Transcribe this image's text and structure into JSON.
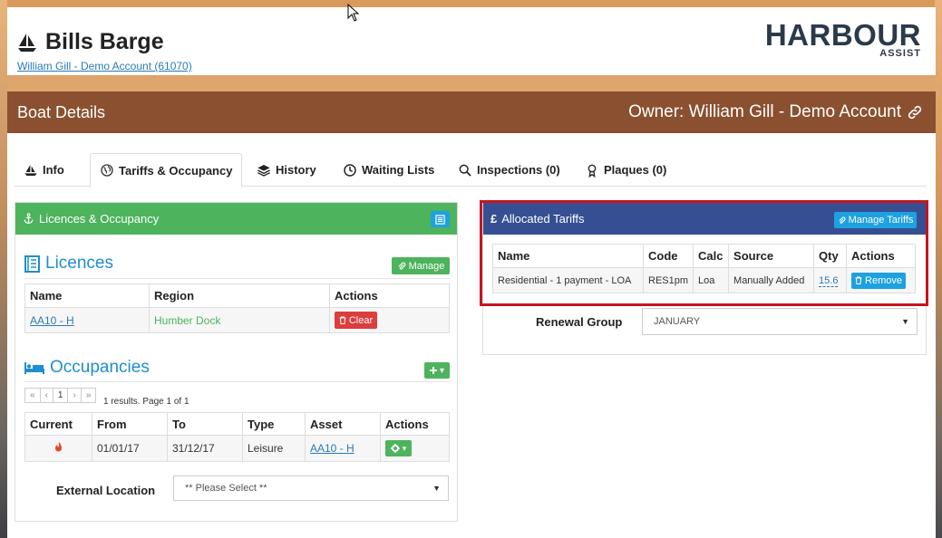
{
  "header": {
    "boat_name": "Bills Barge",
    "account_link": "William Gill - Demo Account (61070)",
    "logo_main": "HARBOUR",
    "logo_sub": "ASSIST"
  },
  "main": {
    "title": "Boat Details",
    "owner": "Owner: William Gill - Demo Account"
  },
  "tabs": [
    {
      "label": "Info"
    },
    {
      "label": "Tariffs & Occupancy"
    },
    {
      "label": "History"
    },
    {
      "label": "Waiting Lists"
    },
    {
      "label": "Inspections (0)"
    },
    {
      "label": "Plaques (0)"
    }
  ],
  "licences_panel": {
    "title": "Licences & Occupancy",
    "licences_title": "Licences",
    "manage_label": "Manage",
    "columns": [
      "Name",
      "Region",
      "Actions"
    ],
    "rows": [
      {
        "name": "AA10 - H",
        "region": "Humber Dock",
        "action": "Clear"
      }
    ],
    "occupancies_title": "Occupancies",
    "pager": [
      "«",
      "‹",
      "1",
      "›",
      "»"
    ],
    "pager_info": "1 results. Page 1 of 1",
    "occ_columns": [
      "Current",
      "From",
      "To",
      "Type",
      "Asset",
      "Actions"
    ],
    "occ_rows": [
      {
        "from": "01/01/17",
        "to": "31/12/17",
        "type": "Leisure",
        "asset": "AA10 - H"
      }
    ],
    "external_location_label": "External Location",
    "external_location_value": "** Please Select **"
  },
  "tariffs_panel": {
    "title": "Allocated Tariffs",
    "manage_label": "Manage Tariffs",
    "columns": [
      "Name",
      "Code",
      "Calc",
      "Source",
      "Qty",
      "Actions"
    ],
    "rows": [
      {
        "name": "Residential - 1 payment - LOA",
        "code": "RES1pm",
        "calc": "Loa",
        "source": "Manually Added",
        "qty": "15.6",
        "action": "Remove"
      }
    ],
    "renewal_label": "Renewal Group",
    "renewal_value": "JANUARY"
  },
  "colors": {
    "header_brown": "#8b5030",
    "green": "#4db35c",
    "navy": "#364f93",
    "link_blue": "#2a7ab8",
    "highlight_red": "#c8141e"
  }
}
